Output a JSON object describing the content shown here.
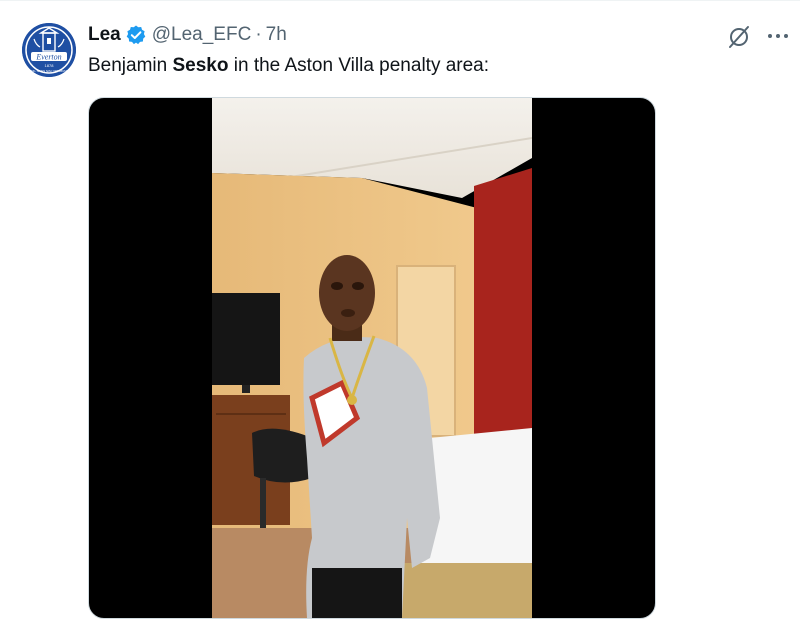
{
  "author": {
    "display_name": "Lea",
    "handle": "@Lea_EFC",
    "separator": "·",
    "time": "7h",
    "avatar_text": "Everton",
    "avatar_year": "1878",
    "avatar_motto": "NIL SATIS NISI OPTIMUM",
    "verified": true
  },
  "tweet": {
    "text_before": "Benjamin ",
    "text_bold": "Sesko",
    "text_after": " in the Aston Villa penalty area:"
  },
  "actions": {
    "grok_icon": "grok-icon",
    "more_icon": "more-options-icon"
  },
  "colors": {
    "verified_blue": "#1d9bf0",
    "secondary_text": "#536471",
    "everton_blue": "#1f4fa3"
  }
}
